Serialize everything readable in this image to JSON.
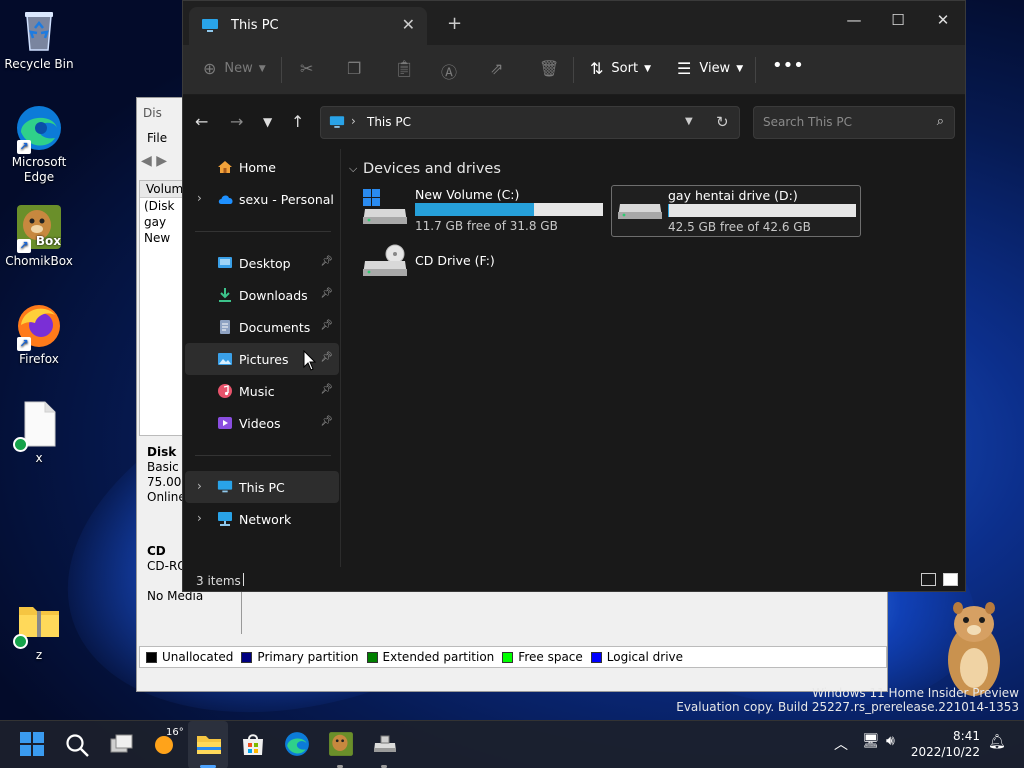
{
  "desktop": {
    "icons": [
      {
        "name": "recycle-bin",
        "label": "Recycle Bin"
      },
      {
        "name": "microsoft-edge",
        "label": "Microsoft Edge"
      },
      {
        "name": "chomikbox",
        "label": "ChomikBox",
        "glyph_text": "Box"
      },
      {
        "name": "firefox",
        "label": "Firefox"
      },
      {
        "name": "x",
        "label": "x"
      },
      {
        "name": "z",
        "label": "z"
      }
    ]
  },
  "disk_management": {
    "title": "Dis",
    "menu_file": "File",
    "volume_header": "Volume",
    "volumes": [
      "(Disk",
      "gay",
      "New"
    ],
    "disk0": [
      "Disk",
      "Basic",
      "75.00 G",
      "Online"
    ],
    "cdrom": [
      "CD",
      "CD-RO",
      "",
      "No Media"
    ],
    "legend": [
      {
        "label": "Unallocated",
        "color": "#000000"
      },
      {
        "label": "Primary partition",
        "color": "#000080"
      },
      {
        "label": "Extended partition",
        "color": "#008000"
      },
      {
        "label": "Free space",
        "color": "#00ff00"
      },
      {
        "label": "Logical drive",
        "color": "#0000ff"
      }
    ]
  },
  "explorer": {
    "tab_title": "This PC",
    "commands": {
      "new": "New",
      "sort": "Sort",
      "view": "View"
    },
    "address": "This PC",
    "search_placeholder": "Search This PC",
    "nav": {
      "home": "Home",
      "onedrive": "sexu - Personal",
      "desktop": "Desktop",
      "downloads": "Downloads",
      "documents": "Documents",
      "pictures": "Pictures",
      "music": "Music",
      "videos": "Videos",
      "this_pc": "This PC",
      "network": "Network"
    },
    "group_header": "Devices and drives",
    "drives": [
      {
        "name": "New Volume (C:)",
        "free": "11.7 GB free of 31.8 GB",
        "used_fraction": 0.632
      },
      {
        "name": "gay hentai drive (D:)",
        "free": "42.5 GB free of 42.6 GB",
        "used_fraction": 0.002
      },
      {
        "name": "CD Drive (F:)"
      }
    ],
    "status": "3 items"
  },
  "taskbar": {
    "weather_temp": "16°",
    "time": "8:41",
    "date": "2022/10/22"
  },
  "watermark": {
    "line1": "Windows 11 Home Insider Preview",
    "line2": "Evaluation copy. Build 25227.rs_prerelease.221014-1353"
  },
  "colors": {
    "accent": "#26a0da",
    "explorer_bg": "#191919",
    "command_bar": "#2b2b2b"
  }
}
